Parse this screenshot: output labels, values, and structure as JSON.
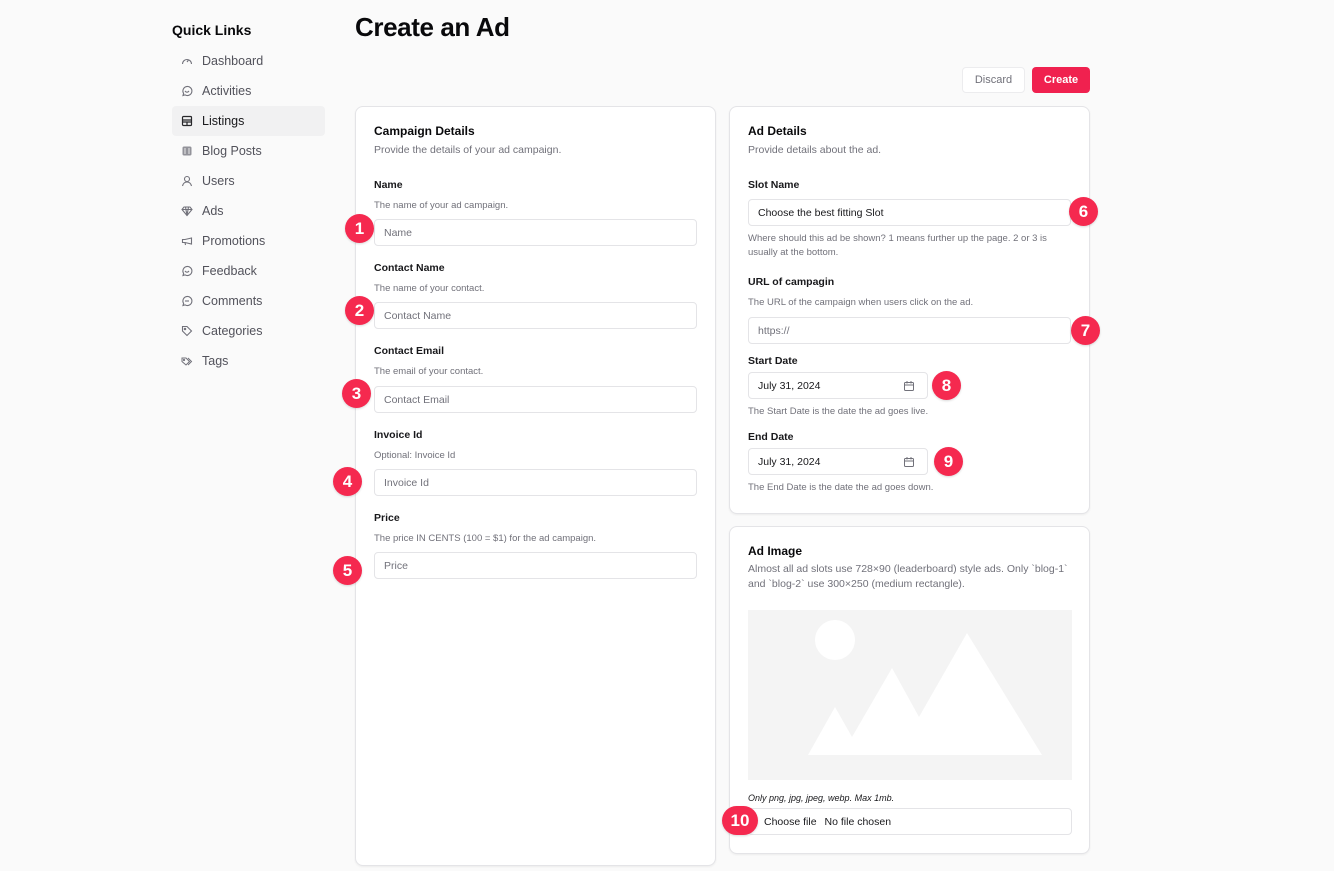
{
  "sidebar": {
    "title": "Quick Links",
    "items": [
      {
        "label": "Dashboard",
        "icon": "gauge-icon",
        "active": false
      },
      {
        "label": "Activities",
        "icon": "activity-chat-icon",
        "active": false
      },
      {
        "label": "Listings",
        "icon": "listings-icon",
        "active": true
      },
      {
        "label": "Blog Posts",
        "icon": "newspaper-icon",
        "active": false
      },
      {
        "label": "Users",
        "icon": "user-icon",
        "active": false
      },
      {
        "label": "Ads",
        "icon": "diamond-icon",
        "active": false
      },
      {
        "label": "Promotions",
        "icon": "megaphone-icon",
        "active": false
      },
      {
        "label": "Feedback",
        "icon": "feedback-icon",
        "active": false
      },
      {
        "label": "Comments",
        "icon": "comment-icon",
        "active": false
      },
      {
        "label": "Categories",
        "icon": "tag-icon",
        "active": false
      },
      {
        "label": "Tags",
        "icon": "tags-icon",
        "active": false
      }
    ]
  },
  "header": {
    "title": "Create an Ad",
    "discard_label": "Discard",
    "create_label": "Create"
  },
  "campaign": {
    "title": "Campaign Details",
    "subtitle": "Provide the details of your ad campaign.",
    "fields": [
      {
        "label": "Name",
        "help": "The name of your ad campaign.",
        "placeholder": "Name",
        "value": ""
      },
      {
        "label": "Contact Name",
        "help": "The name of your contact.",
        "placeholder": "Contact Name",
        "value": ""
      },
      {
        "label": "Contact Email",
        "help": "The email of your contact.",
        "placeholder": "Contact Email",
        "value": ""
      },
      {
        "label": "Invoice Id",
        "help": "Optional: Invoice Id",
        "placeholder": "Invoice Id",
        "value": ""
      },
      {
        "label": "Price",
        "help": "The price IN CENTS (100 = $1) for the ad campaign.",
        "placeholder": "Price",
        "value": ""
      }
    ]
  },
  "ad_details": {
    "title": "Ad Details",
    "subtitle": "Provide details about the ad.",
    "slot": {
      "label": "Slot Name",
      "selected": "Choose the best fitting Slot",
      "help": "Where should this ad be shown? 1 means further up the page. 2 or 3 is usually at the bottom."
    },
    "url": {
      "label": "URL of campagin",
      "help": "The URL of the campaign when users click on the ad.",
      "placeholder": "https://",
      "value": ""
    },
    "start_date": {
      "label": "Start Date",
      "value": "July 31, 2024",
      "help": "The Start Date is the date the ad goes live."
    },
    "end_date": {
      "label": "End Date",
      "value": "July 31, 2024",
      "help": "The End Date is the date the ad goes down."
    }
  },
  "ad_image": {
    "title": "Ad Image",
    "subtitle": "Almost all ad slots use 728×90 (leaderboard) style ads. Only `blog-1` and `blog-2` use 300×250 (medium rectangle).",
    "note": "Only png, jpg, jpeg, webp. Max 1mb.",
    "choose_label": "Choose file",
    "file_status": "No file chosen"
  },
  "badges": [
    "1",
    "2",
    "3",
    "4",
    "5",
    "6",
    "7",
    "8",
    "9",
    "10"
  ],
  "colors": {
    "accent": "#f0214f",
    "badge": "#f5294f",
    "background": "#fafafa"
  }
}
